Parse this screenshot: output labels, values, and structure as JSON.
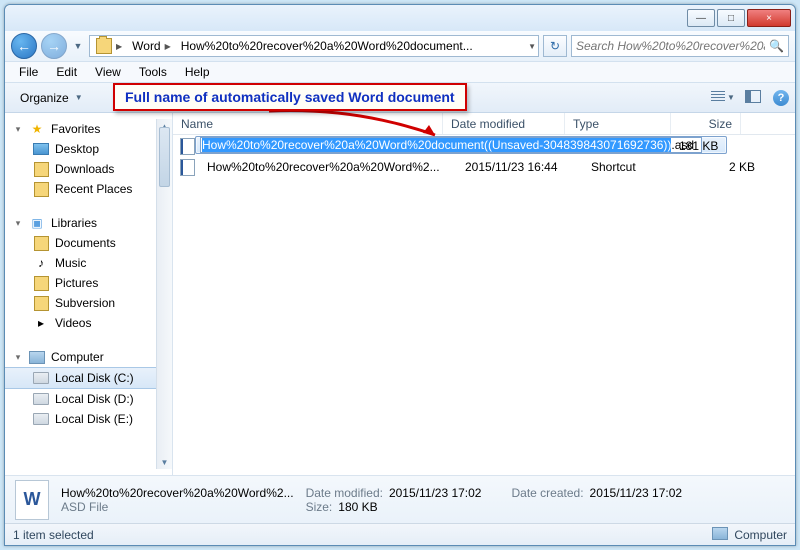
{
  "window_controls": {
    "min": "—",
    "max": "□",
    "close": "×"
  },
  "nav": {
    "back": "←",
    "forward": "→"
  },
  "breadcrumb": {
    "segments": [
      "Word",
      "How%20to%20recover%20a%20Word%20document..."
    ]
  },
  "searchbox": {
    "placeholder": "Search How%20to%20recover%20a%2..."
  },
  "menubar": [
    "File",
    "Edit",
    "View",
    "Tools",
    "Help"
  ],
  "toolbar": {
    "organize": "Organize"
  },
  "callout": {
    "text": "Full name of automatically saved Word document"
  },
  "sidebar": {
    "favorites": {
      "label": "Favorites",
      "items": [
        "Desktop",
        "Downloads",
        "Recent Places"
      ]
    },
    "libraries": {
      "label": "Libraries",
      "items": [
        "Documents",
        "Music",
        "Pictures",
        "Subversion",
        "Videos"
      ]
    },
    "computer": {
      "label": "Computer",
      "items": [
        "Local Disk (C:)",
        "Local Disk (D:)",
        "Local Disk (E:)"
      ]
    }
  },
  "columns": {
    "name": "Name",
    "date": "Date modified",
    "type": "Type",
    "size": "Size"
  },
  "files": [
    {
      "selected_name_highlight": "How%20to%20recover%20a%20Word%20document((Unsaved-304839843071692736))",
      "ext": ".asd",
      "date": "",
      "type": "",
      "size": "181 KB"
    },
    {
      "name": "How%20to%20recover%20a%20Word%2...",
      "date": "2015/11/23 16:44",
      "type": "Shortcut",
      "size": "2 KB"
    }
  ],
  "details": {
    "name": "How%20to%20recover%20a%20Word%2...",
    "subtype": "ASD File",
    "pairs": {
      "date_modified_k": "Date modified:",
      "date_modified_v": "2015/11/23 17:02",
      "size_k": "Size:",
      "size_v": "180 KB",
      "date_created_k": "Date created:",
      "date_created_v": "2015/11/23 17:02"
    }
  },
  "statusbar": {
    "selection": "1 item selected",
    "location": "Computer"
  }
}
